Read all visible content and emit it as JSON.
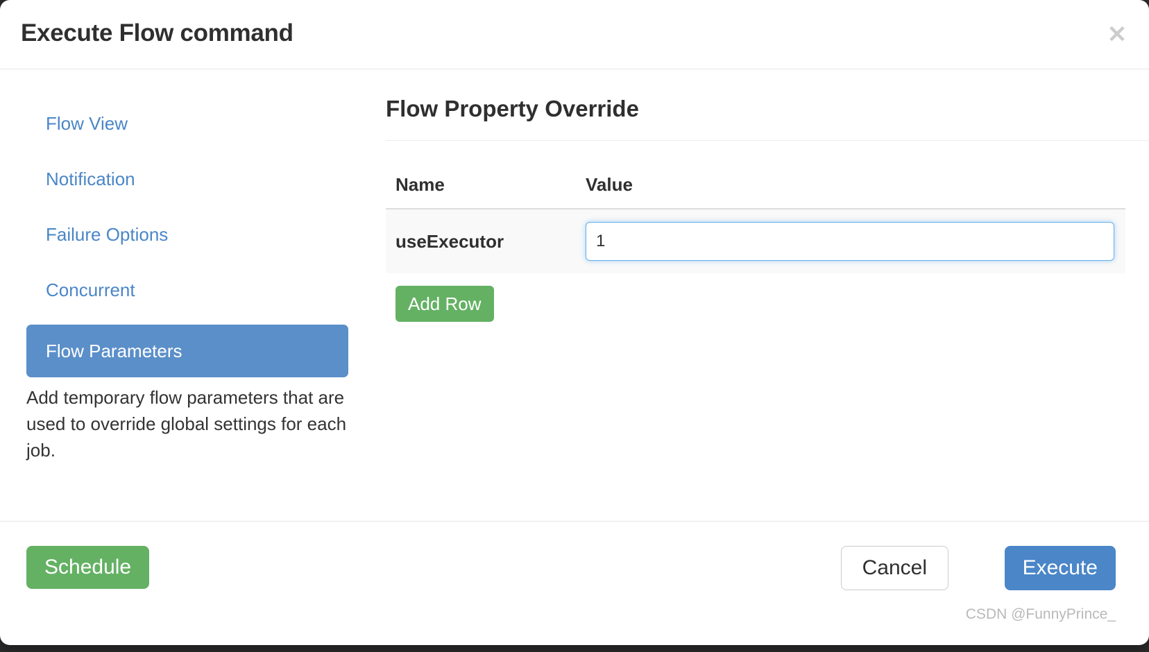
{
  "dialog": {
    "title": "Execute Flow command",
    "close_icon": "close-icon",
    "close_glyph": "✕"
  },
  "sidebar": {
    "items": [
      {
        "label": "Flow View",
        "active": false
      },
      {
        "label": "Notification",
        "active": false
      },
      {
        "label": "Failure Options",
        "active": false
      },
      {
        "label": "Concurrent",
        "active": false
      },
      {
        "label": "Flow Parameters",
        "active": true
      }
    ],
    "description": "Add temporary flow parameters that are used to override global settings for each job."
  },
  "content": {
    "title": "Flow Property Override",
    "table": {
      "columns": [
        "Name",
        "Value"
      ],
      "rows": [
        {
          "name": "useExecutor",
          "value": "1"
        }
      ]
    },
    "add_row_label": "Add Row"
  },
  "footer": {
    "schedule_label": "Schedule",
    "cancel_label": "Cancel",
    "execute_label": "Execute"
  },
  "watermark": "CSDN @FunnyPrince_",
  "colors": {
    "accent_blue": "#4a86c8",
    "active_nav_blue": "#5b8fc9",
    "green": "#64b164",
    "focus_border": "#66afe9",
    "row_background": "#f9f9f9",
    "text_dark": "#2f2f2f"
  }
}
